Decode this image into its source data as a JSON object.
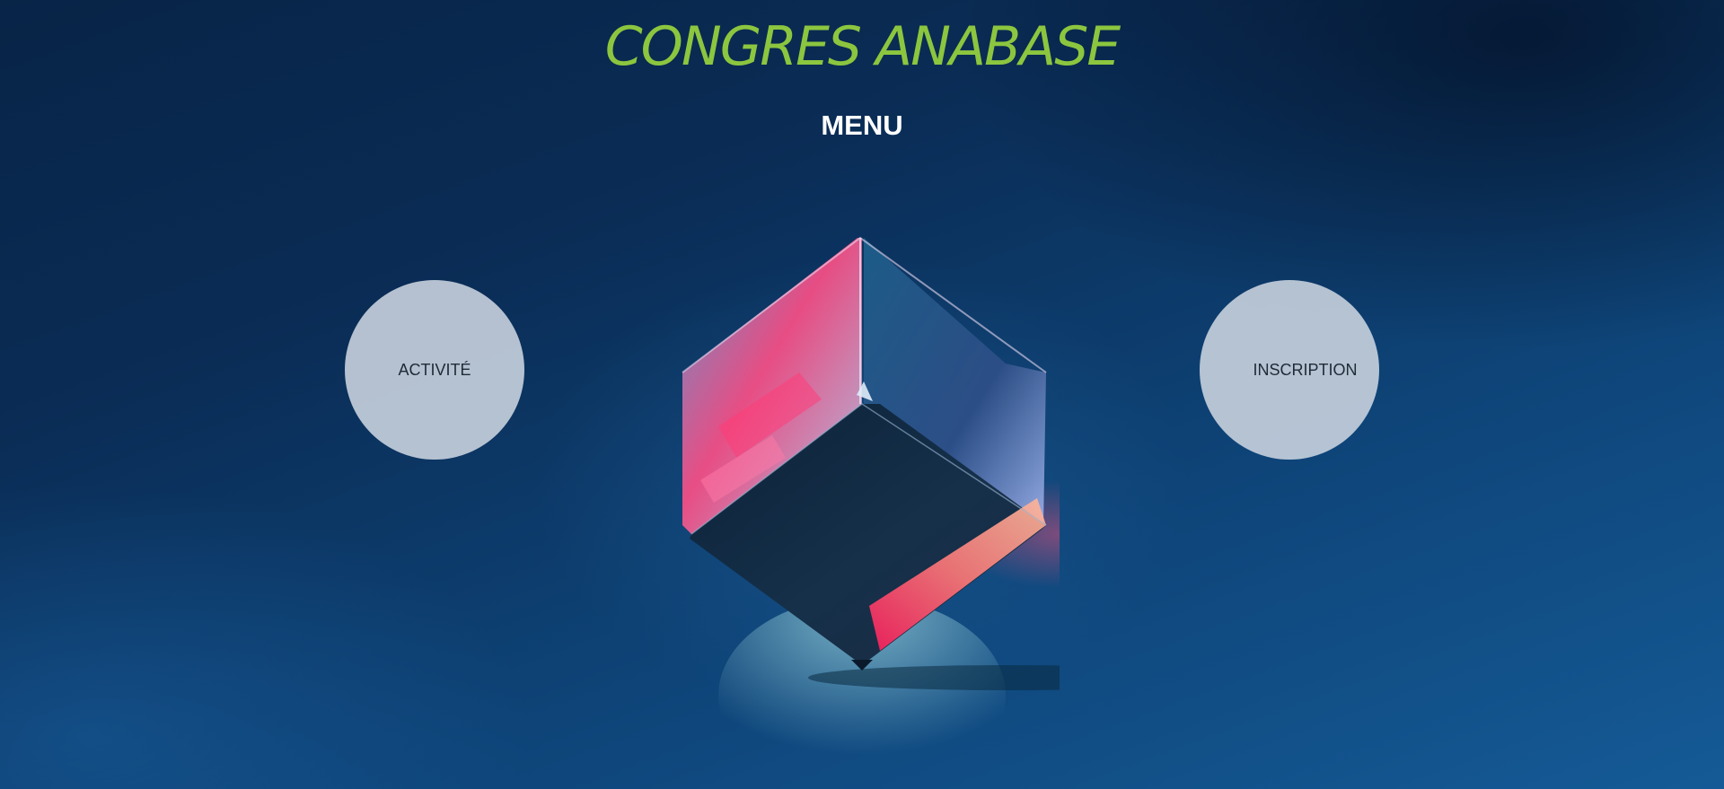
{
  "header": {
    "title": "CONGRES ANABASE",
    "menu_label": "MENU"
  },
  "menu": {
    "items": [
      {
        "label": "ACTIVITÉ"
      },
      {
        "label": "INSCRIPTION"
      }
    ]
  },
  "colors": {
    "title": "#8cc63f",
    "menu_heading": "#ffffff",
    "circle_button": "#c8d2de",
    "background_dark": "#082447",
    "background_light": "#155a96",
    "crystal_pink": "#ff3c78"
  },
  "decorations": {
    "hero_image": "glass-cube-icon"
  }
}
